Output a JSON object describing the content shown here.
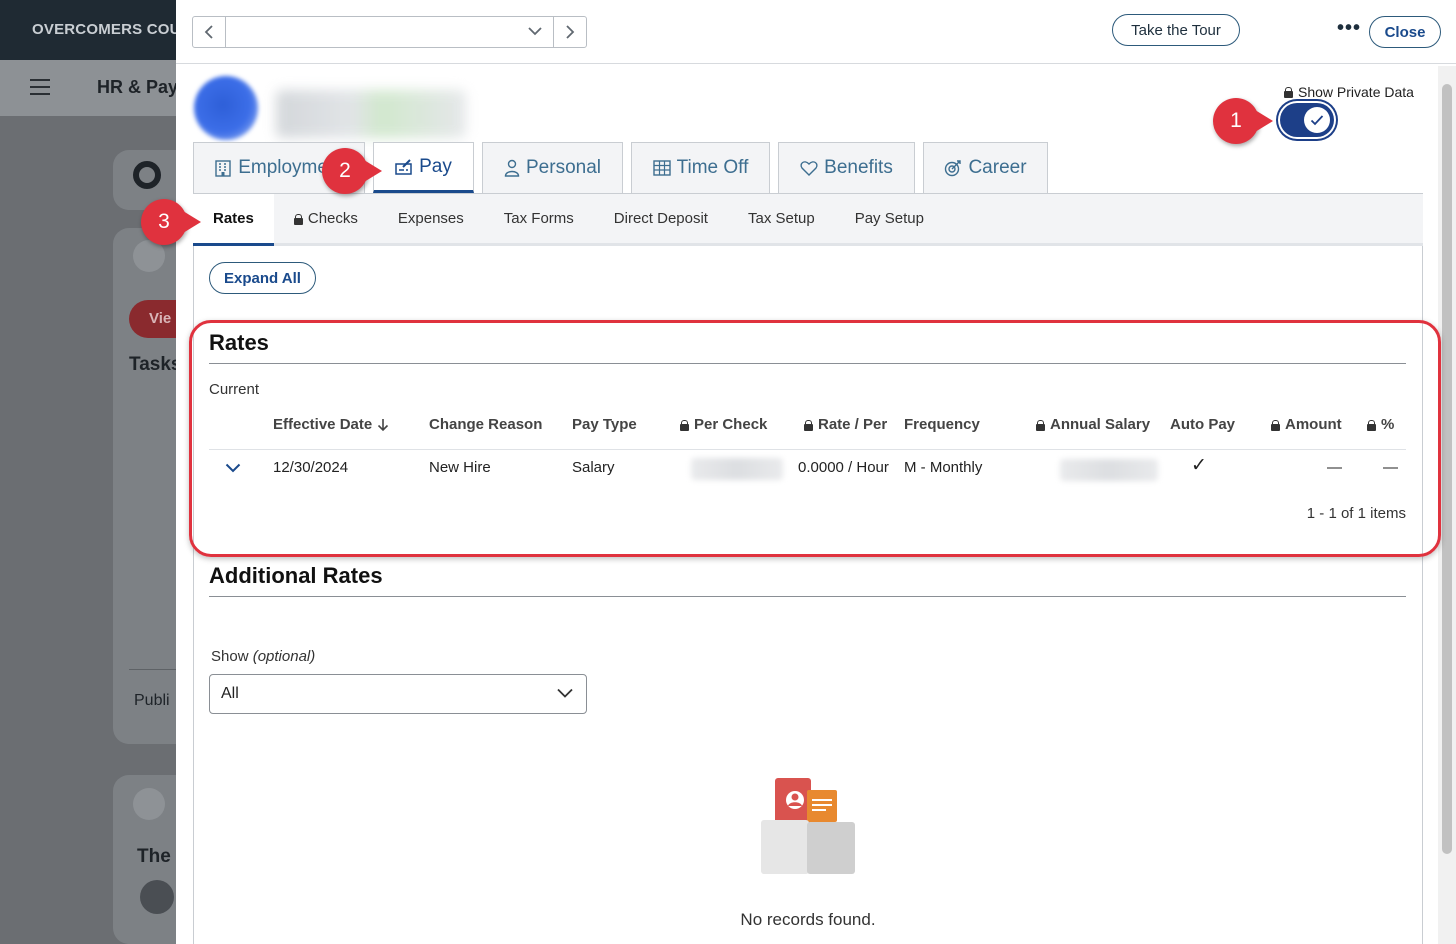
{
  "background": {
    "org_name": "OVERCOMERS COU",
    "section_title": "HR & Pay",
    "view_button": "Vie",
    "tasks_heading": "Tasks",
    "public_label": "Publi",
    "card_heading": "The"
  },
  "header": {
    "tour_button": "Take the Tour",
    "more_button": "•••",
    "close_button": "Close"
  },
  "private_data": {
    "label": "Show Private Data",
    "enabled": true
  },
  "main_tabs": [
    {
      "label": "Employment",
      "icon": "building-icon"
    },
    {
      "label": "Pay",
      "icon": "paycheck-icon",
      "active": true
    },
    {
      "label": "Personal",
      "icon": "person-icon"
    },
    {
      "label": "Time Off",
      "icon": "calendar-grid-icon"
    },
    {
      "label": "Benefits",
      "icon": "heart-icon"
    },
    {
      "label": "Career",
      "icon": "target-icon"
    }
  ],
  "sub_tabs": [
    {
      "label": "Rates",
      "active": true
    },
    {
      "label": "Checks",
      "locked": true
    },
    {
      "label": "Expenses"
    },
    {
      "label": "Tax Forms"
    },
    {
      "label": "Direct Deposit"
    },
    {
      "label": "Tax Setup"
    },
    {
      "label": "Pay Setup"
    }
  ],
  "expand_all": "Expand All",
  "rates": {
    "title": "Rates",
    "current_label": "Current",
    "columns": {
      "effective_date": "Effective Date",
      "change_reason": "Change Reason",
      "pay_type": "Pay Type",
      "per_check": "Per Check",
      "rate_per": "Rate / Per",
      "frequency": "Frequency",
      "annual_salary": "Annual Salary",
      "auto_pay": "Auto Pay",
      "amount": "Amount",
      "percent": "%"
    },
    "row": {
      "effective_date": "12/30/2024",
      "change_reason": "New Hire",
      "pay_type": "Salary",
      "rate_per": "0.0000 / Hour",
      "frequency": "M - Monthly",
      "auto_pay": "✓",
      "amount": "—",
      "percent": "—"
    },
    "pager": "1 - 1 of 1 items"
  },
  "additional_rates": {
    "title": "Additional Rates",
    "show_label": "Show",
    "show_optional": "(optional)",
    "show_value": "All",
    "empty_text": "No records found."
  },
  "callouts": [
    "1",
    "2",
    "3"
  ],
  "colors": {
    "accent": "#1a4a8c",
    "callout": "#e0323e",
    "toggle": "#1d3f88"
  }
}
